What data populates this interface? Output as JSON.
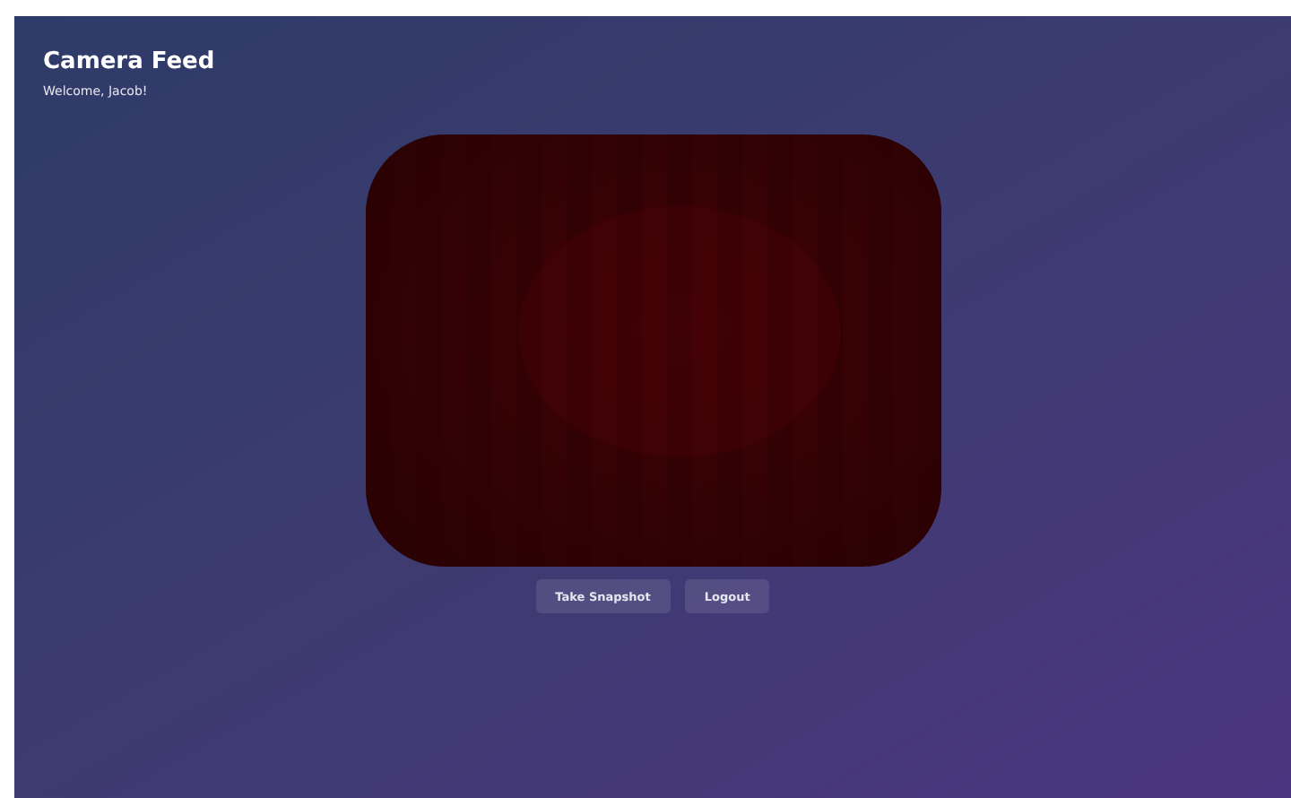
{
  "header": {
    "title": "Camera Feed",
    "welcome": "Welcome, Jacob!"
  },
  "buttons": [
    {
      "label": "Take Snapshot"
    },
    {
      "label": "Logout"
    }
  ]
}
